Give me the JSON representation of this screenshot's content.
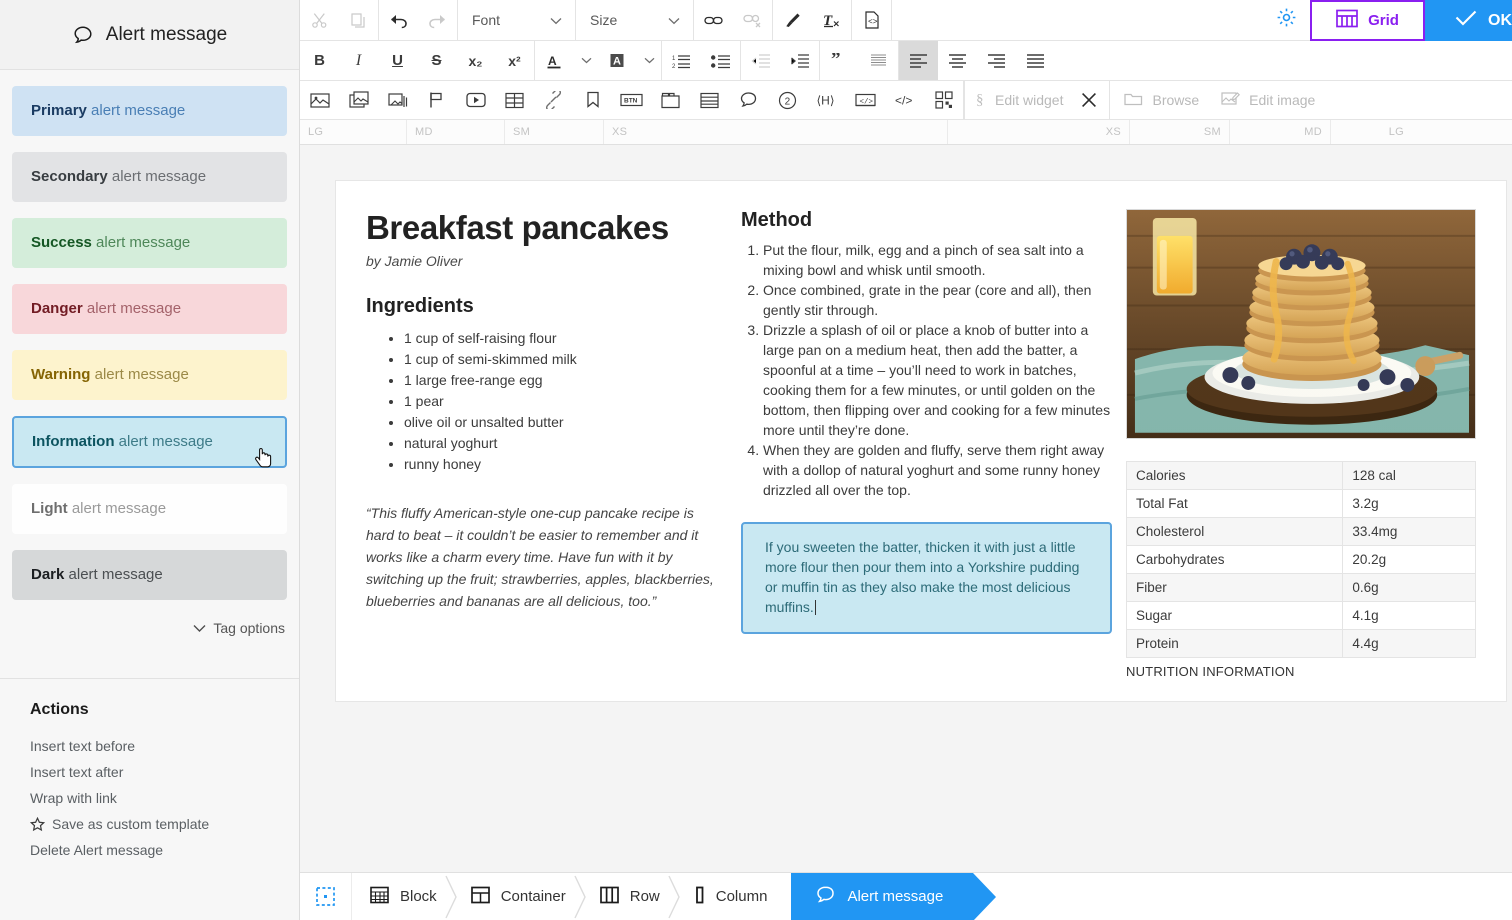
{
  "sidebar": {
    "header": {
      "title": "Alert message",
      "icon": "speech-bubble-icon"
    },
    "alerts": [
      {
        "variant": "primary",
        "strong": "Primary",
        "rest": " alert message"
      },
      {
        "variant": "secondary",
        "strong": "Secondary",
        "rest": " alert message"
      },
      {
        "variant": "success",
        "strong": "Success",
        "rest": " alert message"
      },
      {
        "variant": "danger",
        "strong": "Danger",
        "rest": " alert message"
      },
      {
        "variant": "warning",
        "strong": "Warning",
        "rest": " alert message"
      },
      {
        "variant": "info",
        "strong": "Information",
        "rest": " alert message",
        "selected": true
      },
      {
        "variant": "light",
        "strong": "Light",
        "rest": " alert message"
      },
      {
        "variant": "dark",
        "strong": "Dark",
        "rest": " alert message"
      }
    ],
    "tag_options_label": "Tag options",
    "actions_heading": "Actions",
    "actions": [
      {
        "label": "Insert text before",
        "icon": null
      },
      {
        "label": "Insert text after",
        "icon": null
      },
      {
        "label": "Wrap with link",
        "icon": null
      },
      {
        "label": "Save as custom template",
        "icon": "star-icon"
      },
      {
        "label": "Delete Alert message",
        "icon": null
      }
    ]
  },
  "toolbar": {
    "row1": {
      "cut_icon": "scissors-icon",
      "copy_icon": "copy-icon",
      "undo_icon": "undo-arrow-icon",
      "redo_icon": "redo-arrow-icon",
      "font_select": "Font",
      "size_select": "Size",
      "link_icon": "link-icon",
      "unlink_icon": "unlink-icon",
      "brush_icon": "paint-brush-icon",
      "clear_format_icon": "clear-formatting-icon",
      "source_icon": "source-code-file-icon",
      "gear_icon": "gear-icon",
      "grid_label": "Grid",
      "grid_icon": "grid-table-icon",
      "ok_label": "OK",
      "ok_icon": "checkmark-icon"
    },
    "row2": {
      "bold": "B",
      "italic": "I",
      "underline": "U",
      "strike": "S",
      "subscript": "x₂",
      "superscript": "x²",
      "text_color_icon": "text-color-a-icon",
      "text_color_caret": "chevron-down-icon",
      "highlight_icon": "highlight-color-a-icon",
      "highlight_caret": "chevron-down-icon",
      "ordered_list_icon": "numbered-list-icon",
      "unordered_list_icon": "bulleted-list-icon",
      "outdent_icon": "decrease-indent-icon",
      "indent_icon": "increase-indent-icon",
      "blockquote_icon": "blockquote-icon",
      "justify_icon": "justify-text-icon",
      "align_left_icon": "align-left-icon",
      "align_center_icon": "align-center-icon",
      "align_right_icon": "align-right-icon",
      "align_block_icon": "align-block-icon"
    },
    "row3": {
      "image_icon": "insert-image-icon",
      "gallery_icon": "image-gallery-icon",
      "slider_icon": "image-slider-icon",
      "flag_icon": "flag-icon",
      "video_icon": "video-player-icon",
      "table_icon": "insert-table-icon",
      "anchor_link_icon": "chain-link-icon",
      "bookmark_icon": "bookmark-icon",
      "button_icon": "btn-button-icon",
      "tabs_icon": "tabs-panel-icon",
      "accordion_icon": "accordion-rows-icon",
      "comment_icon": "speech-bubble-icon",
      "help_icon": "circled-number-2-icon",
      "heading_tag_icon": "heading-tag-icon",
      "embed_code_icon": "embed-code-box-icon",
      "html_code_icon": "html-code-icon",
      "qr_icon": "qr-blocks-icon",
      "edit_widget_label": "Edit widget",
      "edit_widget_icon": "section-symbol-icon",
      "close_icon": "close-x-icon",
      "browse_label": "Browse",
      "browse_icon": "folder-icon",
      "edit_image_label": "Edit image",
      "edit_image_icon": "edit-image-pencil-icon"
    }
  },
  "ruler": {
    "left": [
      "LG",
      "MD",
      "SM",
      "XS"
    ],
    "right": [
      "XS",
      "SM",
      "MD",
      "LG"
    ]
  },
  "document": {
    "title": "Breakfast pancakes",
    "byline": "by Jamie Oliver",
    "ingredients_heading": "Ingredients",
    "ingredients": [
      "1 cup of self-raising flour",
      "1 cup of semi-skimmed milk",
      "1 large free-range egg",
      "1 pear",
      "olive oil or unsalted butter",
      "natural yoghurt",
      "runny honey"
    ],
    "quote": "“This fluffy American-style one-cup pancake recipe is hard to beat – it couldn’t be easier to remember and it works like a charm every time. Have fun with it by switching up the fruit; strawberries, apples, blackberries, blueberries and bananas are all delicious, too.”",
    "method_heading": "Method",
    "method": [
      "Put the flour, milk, egg and a pinch of sea salt into a mixing bowl and whisk until smooth.",
      "Once combined, grate in the pear (core and all), then gently stir through.",
      "Drizzle a splash of oil or place a knob of butter into a large pan on a medium heat, then add the batter, a spoonful at a time – you’ll need to work in batches, cooking them for a few minutes, or until golden on the bottom, then flipping over and cooking for a few minutes more until they’re done.",
      "When they are golden and fluffy, serve them right away with a dollop of natural yoghurt and some runny honey drizzled all over the top."
    ],
    "tip_alert": "If you sweeten the batter, thicken it with just a little more flour then pour them into a Yorkshire pudding or muffin tin as they also make the most delicious muffins.",
    "photo_alt": "stack-of-pancakes-with-blueberries-photo",
    "nutrition": {
      "caption": "NUTRITION INFORMATION",
      "rows": [
        {
          "label": "Calories",
          "value": "128 cal"
        },
        {
          "label": "Total Fat",
          "value": "3.2g"
        },
        {
          "label": "Cholesterol",
          "value": "33.4mg"
        },
        {
          "label": "Carbohydrates",
          "value": "20.2g"
        },
        {
          "label": "Fiber",
          "value": "0.6g"
        },
        {
          "label": "Sugar",
          "value": "4.1g"
        },
        {
          "label": "Protein",
          "value": "4.4g"
        }
      ]
    }
  },
  "breadcrumb": {
    "select_icon": "selection-marquee-icon",
    "items": [
      {
        "label": "Block",
        "icon": "block-icon",
        "active": false
      },
      {
        "label": "Container",
        "icon": "container-icon",
        "active": false
      },
      {
        "label": "Row",
        "icon": "row-icon",
        "active": false
      },
      {
        "label": "Column",
        "icon": "column-icon",
        "active": false
      },
      {
        "label": "Alert message",
        "icon": "speech-bubble-icon",
        "active": true
      }
    ]
  },
  "colors": {
    "accent_blue": "#2196f3",
    "grid_purple": "#8a1ff0",
    "info_border": "#5ba4de",
    "info_bg": "#c9e8f2"
  }
}
